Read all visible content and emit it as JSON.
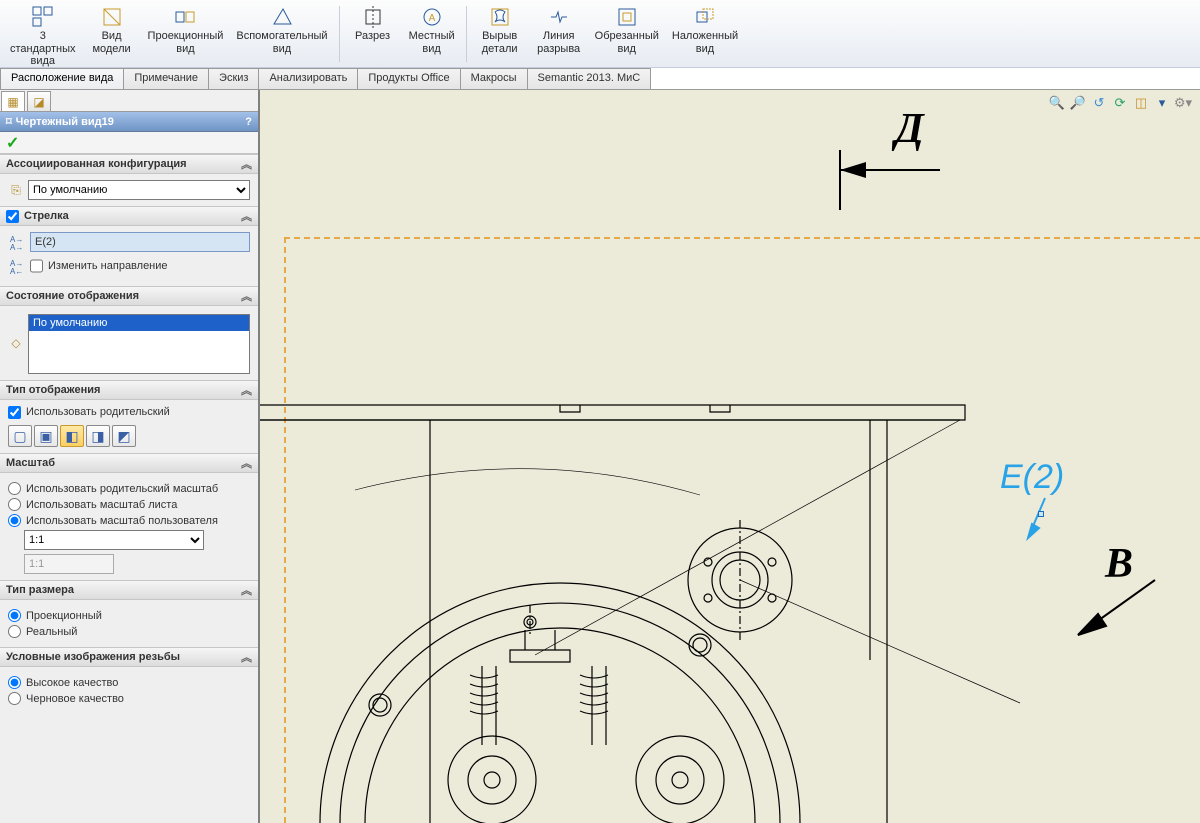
{
  "ribbon": {
    "items": [
      {
        "l1": "3",
        "l2": "стандартных",
        "l3": "вида"
      },
      {
        "l1": "Вид",
        "l2": "модели",
        "l3": ""
      },
      {
        "l1": "Проекционный",
        "l2": "вид",
        "l3": ""
      },
      {
        "l1": "Вспомогательный",
        "l2": "вид",
        "l3": ""
      },
      {
        "l1": "Разрез",
        "l2": "",
        "l3": ""
      },
      {
        "l1": "Местный",
        "l2": "вид",
        "l3": ""
      },
      {
        "l1": "Вырыв",
        "l2": "детали",
        "l3": ""
      },
      {
        "l1": "Линия",
        "l2": "разрыва",
        "l3": ""
      },
      {
        "l1": "Обрезанный",
        "l2": "вид",
        "l3": ""
      },
      {
        "l1": "Наложенный",
        "l2": "вид",
        "l3": ""
      }
    ]
  },
  "tabs": [
    "Расположение вида",
    "Примечание",
    "Эскиз",
    "Анализировать",
    "Продукты Office",
    "Макросы",
    "Semantic 2013. МиС"
  ],
  "panel": {
    "title": "Чертежный вид19",
    "help": "?",
    "check": "✓",
    "sections": {
      "config": {
        "header": "Ассоциированная конфигурация",
        "value": "По умолчанию"
      },
      "arrow": {
        "header": "Стрелка",
        "checked": true,
        "value": "Е(2)",
        "change_dir": "Изменить направление"
      },
      "dispstate": {
        "header": "Состояние отображения",
        "item": "По умолчанию"
      },
      "disptype": {
        "header": "Тип отображения",
        "use_parent": "Использовать родительский"
      },
      "scale": {
        "header": "Масштаб",
        "opt1": "Использовать родительский масштаб",
        "opt2": "Использовать масштаб листа",
        "opt3": "Использовать масштаб пользователя",
        "combo": "1:1",
        "text": "1:1"
      },
      "dimtype": {
        "header": "Тип размера",
        "opt1": "Проекционный",
        "opt2": "Реальный"
      },
      "thread": {
        "header": "Условные изображения резьбы",
        "opt1": "Высокое качество",
        "opt2": "Черновое качество"
      }
    }
  },
  "drawing": {
    "label_D": "Д",
    "label_E": "Е(2)",
    "label_B": "В"
  }
}
